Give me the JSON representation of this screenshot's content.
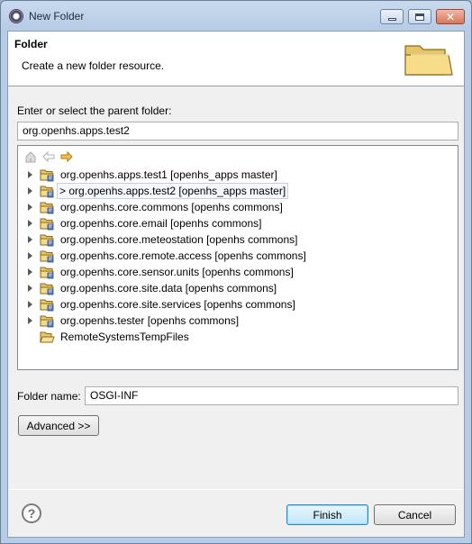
{
  "window": {
    "title": "New Folder"
  },
  "banner": {
    "title": "Folder",
    "description": "Create a new folder resource."
  },
  "parent_folder": {
    "label": "Enter or select the parent folder:",
    "value": "org.openhs.apps.test2"
  },
  "tree": {
    "toolbar": [
      "home-icon",
      "back-arrow-icon",
      "forward-arrow-icon"
    ],
    "items": [
      {
        "label": "org.openhs.apps.test1  [openhs_apps master]",
        "expandable": true,
        "selected": false,
        "icon": "project-folder-icon"
      },
      {
        "label": "> org.openhs.apps.test2  [openhs_apps master]",
        "expandable": true,
        "selected": true,
        "icon": "project-folder-icon"
      },
      {
        "label": "org.openhs.core.commons  [openhs commons]",
        "expandable": true,
        "selected": false,
        "icon": "project-folder-icon"
      },
      {
        "label": "org.openhs.core.email  [openhs commons]",
        "expandable": true,
        "selected": false,
        "icon": "project-folder-icon"
      },
      {
        "label": "org.openhs.core.meteostation  [openhs commons]",
        "expandable": true,
        "selected": false,
        "icon": "project-folder-icon"
      },
      {
        "label": "org.openhs.core.remote.access  [openhs commons]",
        "expandable": true,
        "selected": false,
        "icon": "project-folder-icon"
      },
      {
        "label": "org.openhs.core.sensor.units  [openhs commons]",
        "expandable": true,
        "selected": false,
        "icon": "project-folder-icon"
      },
      {
        "label": "org.openhs.core.site.data  [openhs commons]",
        "expandable": true,
        "selected": false,
        "icon": "project-folder-icon"
      },
      {
        "label": "org.openhs.core.site.services  [openhs commons]",
        "expandable": true,
        "selected": false,
        "icon": "project-folder-icon"
      },
      {
        "label": "org.openhs.tester  [openhs commons]",
        "expandable": true,
        "selected": false,
        "icon": "project-folder-icon"
      },
      {
        "label": "RemoteSystemsTempFiles",
        "expandable": false,
        "selected": false,
        "icon": "open-folder-icon"
      }
    ]
  },
  "folder_name": {
    "label": "Folder name:",
    "value": "OSGI-INF"
  },
  "buttons": {
    "advanced": "Advanced >>",
    "finish": "Finish",
    "cancel": "Cancel",
    "help": "?"
  }
}
